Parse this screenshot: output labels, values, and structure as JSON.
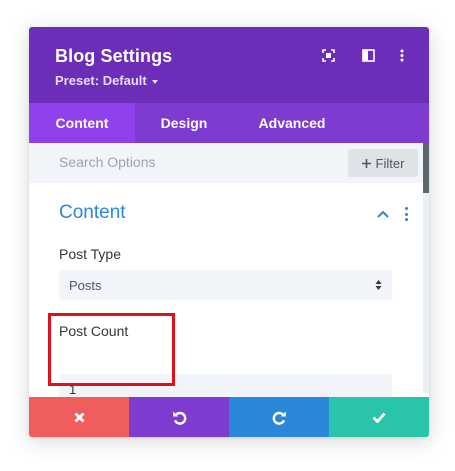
{
  "header": {
    "title": "Blog Settings",
    "preset_label": "Preset: Default"
  },
  "tabs": [
    {
      "label": "Content",
      "active": true
    },
    {
      "label": "Design",
      "active": false
    },
    {
      "label": "Advanced",
      "active": false
    }
  ],
  "search": {
    "placeholder": "Search Options",
    "filter_label": "Filter"
  },
  "section": {
    "title": "Content"
  },
  "fields": {
    "post_type": {
      "label": "Post Type",
      "value": "Posts"
    },
    "post_count": {
      "label": "Post Count",
      "value": "1"
    }
  },
  "footer": {
    "buttons": [
      {
        "icon": "close-icon",
        "color": "#ef5d5d"
      },
      {
        "icon": "undo-icon",
        "color": "#7d3bcf"
      },
      {
        "icon": "redo-icon",
        "color": "#2b87da"
      },
      {
        "icon": "check-icon",
        "color": "#29c4a9"
      }
    ]
  },
  "colors": {
    "header": "#6c2eb9",
    "tabs": "#7d3bcf",
    "active_tab": "#8f42ec",
    "accent_blue": "#2b87da",
    "highlight_red": "#e0101b"
  }
}
